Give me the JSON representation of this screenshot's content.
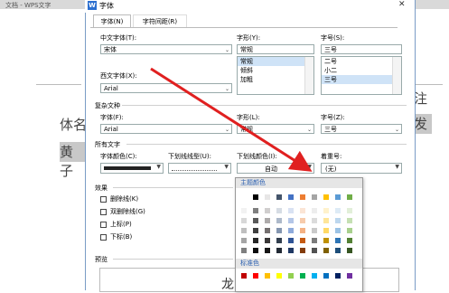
{
  "background": {
    "window_title": "文档 - WPS文字",
    "text_left_1": "体名",
    "text_left_2": "黄子",
    "text_right_1": "注",
    "text_right_2": "发"
  },
  "dialog": {
    "title": "字体",
    "icon_letter": "W",
    "close_label": "✕",
    "tabs": [
      {
        "label": "字体(N)",
        "active": true
      },
      {
        "label": "字符间距(R)",
        "active": false
      }
    ],
    "chinese_font": {
      "label": "中文字体(T):",
      "value": "宋体"
    },
    "style": {
      "label": "字形(Y):",
      "value": "常规",
      "options": [
        "常规",
        "倾斜",
        "加粗"
      ],
      "selected": "常规"
    },
    "size": {
      "label": "字号(S):",
      "value": "三号",
      "options": [
        "二号",
        "小二",
        "三号"
      ],
      "selected": "三号"
    },
    "western_font": {
      "label": "西文字体(X):",
      "value": "Arial"
    },
    "complex_section": "复杂文种",
    "complex_font": {
      "label": "字体(F):",
      "value": "Arial"
    },
    "complex_style": {
      "label": "字形(L):",
      "value": "常规"
    },
    "complex_size": {
      "label": "字号(Z):",
      "value": "三号"
    },
    "all_text_section": "所有文字",
    "font_color": {
      "label": "字体颜色(C):"
    },
    "underline_type": {
      "label": "下划线线型(U):"
    },
    "underline_color": {
      "label": "下划线颜色(I):",
      "value": "自动"
    },
    "emphasis": {
      "label": "着重号:",
      "value": "(无)"
    },
    "effects_section": "效果",
    "effects": [
      {
        "label": "删除线(K)"
      },
      {
        "label": "双删除线(G)"
      },
      {
        "label": "上标(P)"
      },
      {
        "label": "下标(B)"
      }
    ],
    "preview_section": "预览",
    "preview_text": "龙的"
  },
  "palette": {
    "theme_header": "主题颜色",
    "standard_header": "标准色",
    "theme_top_row": [
      "#ffffff",
      "#000000",
      "#e7e6e6",
      "#44546a",
      "#4472c4",
      "#ed7d31",
      "#a5a5a5",
      "#ffc000",
      "#5b9bd5",
      "#70ad47"
    ],
    "theme_shades": [
      [
        "#f2f2f2",
        "#7f7f7f",
        "#d0cece",
        "#d6dce4",
        "#d9e2f3",
        "#fbe5d5",
        "#ededed",
        "#fff2cc",
        "#deebf6",
        "#e2efd9"
      ],
      [
        "#d8d8d8",
        "#595959",
        "#aeabab",
        "#adb9ca",
        "#b4c6e7",
        "#f7cbac",
        "#dbdbdb",
        "#fee599",
        "#bdd7ee",
        "#c5e0b3"
      ],
      [
        "#bfbfbf",
        "#3f3f3f",
        "#757070",
        "#8496b0",
        "#8eaadb",
        "#f4b183",
        "#c9c9c9",
        "#ffd965",
        "#9cc3e5",
        "#a8d08d"
      ],
      [
        "#a5a5a5",
        "#262626",
        "#3a3838",
        "#323f4f",
        "#2f5496",
        "#c55a11",
        "#7b7b7b",
        "#bf9000",
        "#2e75b5",
        "#538135"
      ],
      [
        "#7f7f7f",
        "#0c0c0c",
        "#171616",
        "#222a35",
        "#1f3864",
        "#833c0b",
        "#525252",
        "#7f6000",
        "#1e4e79",
        "#375623"
      ]
    ],
    "standard_colors": [
      "#c00000",
      "#ff0000",
      "#ffc000",
      "#ffff00",
      "#92d050",
      "#00b050",
      "#00b0f0",
      "#0070c0",
      "#002060",
      "#7030a0"
    ],
    "accent_arrow_color": "#e02020"
  }
}
